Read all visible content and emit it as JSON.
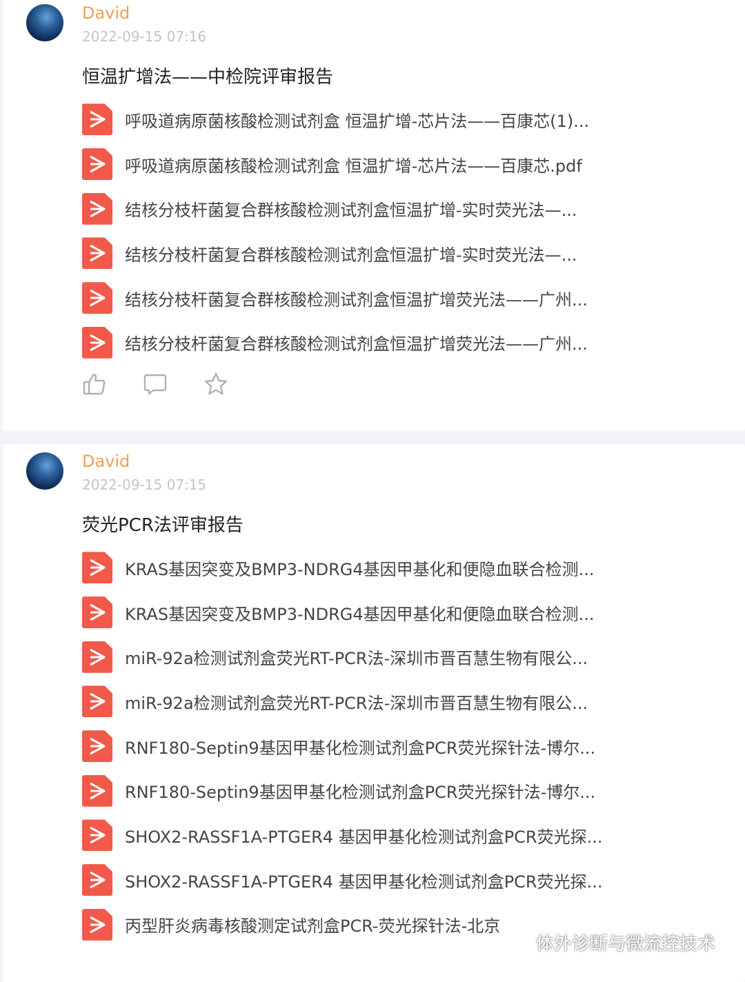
{
  "posts": [
    {
      "author": "David",
      "time": "2022-09-15 07:16",
      "title": "恒温扩增法——中检院评审报告",
      "files": [
        "呼吸道病原菌核酸检测试剂盒 恒温扩增-芯片法——百康芯(1)...",
        "呼吸道病原菌核酸检测试剂盒 恒温扩增-芯片法——百康芯.pdf",
        "结核分枝杆菌复合群核酸检测试剂盒恒温扩增-实时荧光法—...",
        "结核分枝杆菌复合群核酸检测试剂盒恒温扩增-实时荧光法—...",
        "结核分枝杆菌复合群核酸检测试剂盒恒温扩增荧光法——广州...",
        "结核分枝杆菌复合群核酸检测试剂盒恒温扩增荧光法——广州..."
      ],
      "actions": [
        "like-icon",
        "comment-icon",
        "star-icon"
      ]
    },
    {
      "author": "David",
      "time": "2022-09-15 07:15",
      "title": "荧光PCR法评审报告",
      "files": [
        "KRAS基因突变及BMP3-NDRG4基因甲基化和便隐血联合检测...",
        "KRAS基因突变及BMP3-NDRG4基因甲基化和便隐血联合检测...",
        "miR-92a检测试剂盒荧光RT-PCR法-深圳市晋百慧生物有限公...",
        "miR-92a检测试剂盒荧光RT-PCR法-深圳市晋百慧生物有限公...",
        "RNF180-Septin9基因甲基化检测试剂盒PCR荧光探针法-博尔...",
        "RNF180-Septin9基因甲基化检测试剂盒PCR荧光探针法-博尔...",
        "SHOX2-RASSF1A-PTGER4 基因甲基化检测试剂盒PCR荧光探...",
        "SHOX2-RASSF1A-PTGER4 基因甲基化检测试剂盒PCR荧光探...",
        "丙型肝炎病毒核酸测定试剂盒PCR-荧光探针法-北京"
      ]
    }
  ],
  "watermark": "体外诊断与微流控技术",
  "colors": {
    "author": "#f0a052",
    "pdf_icon": "#f15a4a",
    "background": "#f3f4f7"
  }
}
